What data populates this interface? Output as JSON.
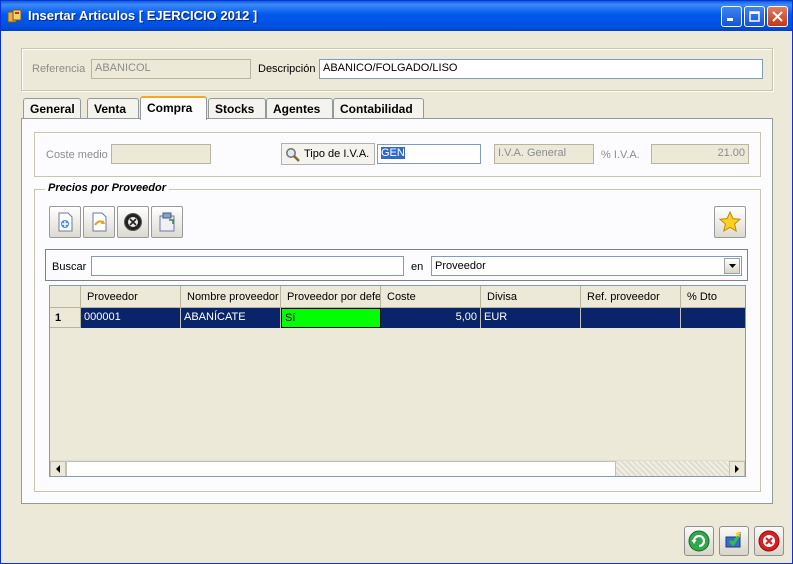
{
  "window": {
    "title": "Insertar Articulos [ EJERCICIO 2012 ]",
    "controls": [
      "minimize-icon",
      "maximize-icon",
      "close-icon"
    ]
  },
  "header": {
    "referencia_label": "Referencia",
    "referencia_value": "ABANICOL",
    "descripcion_label": "Descripción",
    "descripcion_value": "ABANICO/FOLGADO/LISO"
  },
  "tabs": [
    {
      "label": "General",
      "active": false
    },
    {
      "label": "Venta",
      "active": false
    },
    {
      "label": "Compra",
      "active": true
    },
    {
      "label": "Stocks",
      "active": false
    },
    {
      "label": "Agentes",
      "active": false
    },
    {
      "label": "Contabilidad",
      "active": false
    }
  ],
  "compra": {
    "coste_medio_label": "Coste medio",
    "coste_medio_value": "",
    "tipo_iva_label": "Tipo de I.V.A.",
    "tipo_iva_value": "GEN",
    "iva_desc_value": "I.V.A. General",
    "pct_iva_label": "% I.V.A.",
    "pct_iva_value": "21.00"
  },
  "precios": {
    "group_title": "Precios por Proveedor",
    "toolbar": [
      "new-record-icon",
      "edit-record-icon",
      "delete-record-icon",
      "paste-record-icon"
    ],
    "favorite_icon": "star-icon",
    "buscar_label": "Buscar",
    "buscar_value": "",
    "en_label": "en",
    "en_value": "Proveedor",
    "columns": [
      "Proveedor",
      "Nombre proveedor",
      "Proveedor por defe",
      "Coste",
      "Divisa",
      "Ref. proveedor",
      "% Dto"
    ],
    "rows": [
      {
        "num": "1",
        "cells": [
          "000001",
          "ABANÍCATE",
          "Sí",
          "5,00",
          "EUR",
          "",
          ""
        ]
      }
    ]
  },
  "footer": {
    "buttons": [
      "refresh-icon",
      "save-icon",
      "cancel-icon"
    ]
  },
  "colors": {
    "titlebar": "#0058ee",
    "selected_row": "#0a246a",
    "default_cell": "#00ff00",
    "active_tab_accent": "#f5a623"
  }
}
